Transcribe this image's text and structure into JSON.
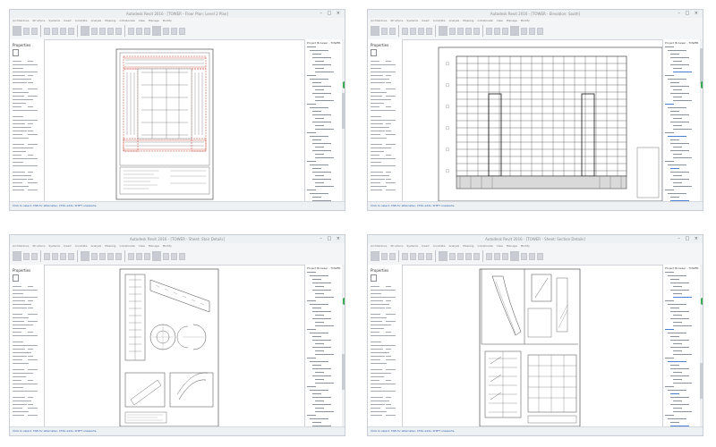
{
  "windows": [
    {
      "title": "Autodesk Revit 2016 - [TOWER - Floor Plan: Level 2 Plan]",
      "status_text": "Click to select, TAB for alternates, CTRL adds, SHIFT unselects.",
      "view": "floor-plan"
    },
    {
      "title": "Autodesk Revit 2016 - [TOWER - Elevation: South]",
      "status_text": "Click to select, TAB for alternates, CTRL adds, SHIFT unselects.",
      "view": "elevation"
    },
    {
      "title": "Autodesk Revit 2016 - [TOWER - Sheet: Stair Details]",
      "status_text": "Click to select, TAB for alternates, CTRL adds, SHIFT unselects.",
      "view": "details-sheet"
    },
    {
      "title": "Autodesk Revit 2016 - [TOWER - Sheet: Section Details]",
      "status_text": "Click to select, TAB for alternates, CTRL adds, SHIFT unselects.",
      "view": "sections-sheet"
    }
  ],
  "ribbon_tabs": [
    "Architecture",
    "Structure",
    "Systems",
    "Insert",
    "Annotate",
    "Analyze",
    "Massing",
    "Collaborate",
    "View",
    "Manage",
    "Modify"
  ],
  "properties_header": "Properties",
  "browser_header": "Project Browser - TOWER",
  "window_controls": "– □ ×",
  "colors": {
    "accent": "#2b5fa8",
    "highlight": "#4a7fd4",
    "drawing_red": "#c0392b",
    "online": "#3aa757"
  },
  "icons": [
    "properties-thumb-icon",
    "minimize-icon",
    "maximize-icon",
    "close-icon"
  ]
}
